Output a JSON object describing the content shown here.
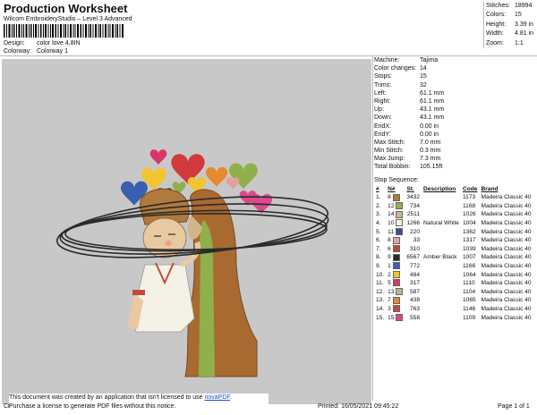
{
  "header": {
    "title": "Production Worksheet",
    "subtitle": "Wilcom EmbroideryStudio – Level 3 Advanced",
    "design_label": "Design:",
    "design_value": "color love 4,8IN",
    "colorway_label": "Colorway:",
    "colorway_value": "Colorway 1"
  },
  "stats": [
    {
      "label": "Stitches:",
      "value": "18994"
    },
    {
      "label": "Colors:",
      "value": "15"
    },
    {
      "label": "Height:",
      "value": "3.39 in"
    },
    {
      "label": "Width:",
      "value": "4.81 in"
    },
    {
      "label": "Zoom:",
      "value": "1:1"
    }
  ],
  "machine": [
    {
      "label": "Machine:",
      "value": "Tajima"
    },
    {
      "label": "Color changes:",
      "value": "14"
    },
    {
      "label": "Stops:",
      "value": "15"
    },
    {
      "label": "Trims:",
      "value": "32"
    },
    {
      "label": "Left:",
      "value": "61.1 mm"
    },
    {
      "label": "Right:",
      "value": "61.1 mm"
    },
    {
      "label": "Up:",
      "value": "43.1 mm"
    },
    {
      "label": "Down:",
      "value": "43.1 mm"
    },
    {
      "label": "EndX:",
      "value": "0.00 in"
    },
    {
      "label": "EndY:",
      "value": "0.00 in"
    },
    {
      "label": "Max Stitch:",
      "value": "7.0 mm"
    },
    {
      "label": "Min Stitch:",
      "value": "0.3 mm"
    },
    {
      "label": "Max Jump:",
      "value": "7.3 mm"
    },
    {
      "label": "Total Bobbin:",
      "value": "105.15ft"
    }
  ],
  "stop_sequence": {
    "label": "Stop Sequence:",
    "headers": [
      "#",
      "N#",
      "St.",
      "Description",
      "Code",
      "Brand"
    ],
    "rows": [
      {
        "n": "1.",
        "nn": "8",
        "color": "#b07a3c",
        "st": "3432",
        "desc": "",
        "code": "1173",
        "brand": "Madeira Classic 40"
      },
      {
        "n": "2.",
        "nn": "12",
        "color": "#8fb04a",
        "st": "734",
        "desc": "",
        "code": "1168",
        "brand": "Madeira Classic 40"
      },
      {
        "n": "3.",
        "nn": "14",
        "color": "#d2b48c",
        "st": "2511",
        "desc": "",
        "code": "1026",
        "brand": "Madeira Classic 40"
      },
      {
        "n": "4.",
        "nn": "10",
        "color": "#f4f1e6",
        "st": "1266",
        "desc": "Natural White",
        "code": "1004",
        "brand": "Madeira Classic 40"
      },
      {
        "n": "5.",
        "nn": "11",
        "color": "#3b4f8c",
        "st": "220",
        "desc": "",
        "code": "1362",
        "brand": "Madeira Classic 40"
      },
      {
        "n": "6.",
        "nn": "8",
        "color": "#e3a39a",
        "st": "33",
        "desc": "",
        "code": "1317",
        "brand": "Madeira Classic 40"
      },
      {
        "n": "7.",
        "nn": "6",
        "color": "#b84a3c",
        "st": "310",
        "desc": "",
        "code": "1039",
        "brand": "Madeira Classic 40"
      },
      {
        "n": "8.",
        "nn": "9",
        "color": "#2a2a2a",
        "st": "6567",
        "desc": "Amber Black",
        "code": "1007",
        "brand": "Madeira Classic 40"
      },
      {
        "n": "9.",
        "nn": "1",
        "color": "#3a5fb0",
        "st": "772",
        "desc": "",
        "code": "1166",
        "brand": "Madeira Classic 40"
      },
      {
        "n": "10.",
        "nn": "2",
        "color": "#f2c431",
        "st": "484",
        "desc": "",
        "code": "1064",
        "brand": "Madeira Classic 40"
      },
      {
        "n": "11.",
        "nn": "5",
        "color": "#d8366a",
        "st": "317",
        "desc": "",
        "code": "1110",
        "brand": "Madeira Classic 40"
      },
      {
        "n": "12.",
        "nn": "13",
        "color": "#b8b88c",
        "st": "587",
        "desc": "",
        "code": "1104",
        "brand": "Madeira Classic 40"
      },
      {
        "n": "13.",
        "nn": "7",
        "color": "#e78a2e",
        "st": "438",
        "desc": "",
        "code": "1065",
        "brand": "Madeira Classic 40"
      },
      {
        "n": "14.",
        "nn": "3",
        "color": "#c24b3a",
        "st": "763",
        "desc": "",
        "code": "1146",
        "brand": "Madeira Classic 40"
      },
      {
        "n": "15.",
        "nn": "15",
        "color": "#d94a8c",
        "st": "558",
        "desc": "",
        "code": "1109",
        "brand": "Madeira Classic 40"
      }
    ]
  },
  "notice": {
    "line1_prefix": "This document was created by an application that isn't licensed to use ",
    "link": "novaPDF",
    "line1_suffix": ".",
    "line2": "Purchase a license to generate PDF files without this notice."
  },
  "footer": {
    "left": "Cr",
    "printed": "Printed: 16/05/2021 09:45:22",
    "page": "Page 1 of 1"
  }
}
